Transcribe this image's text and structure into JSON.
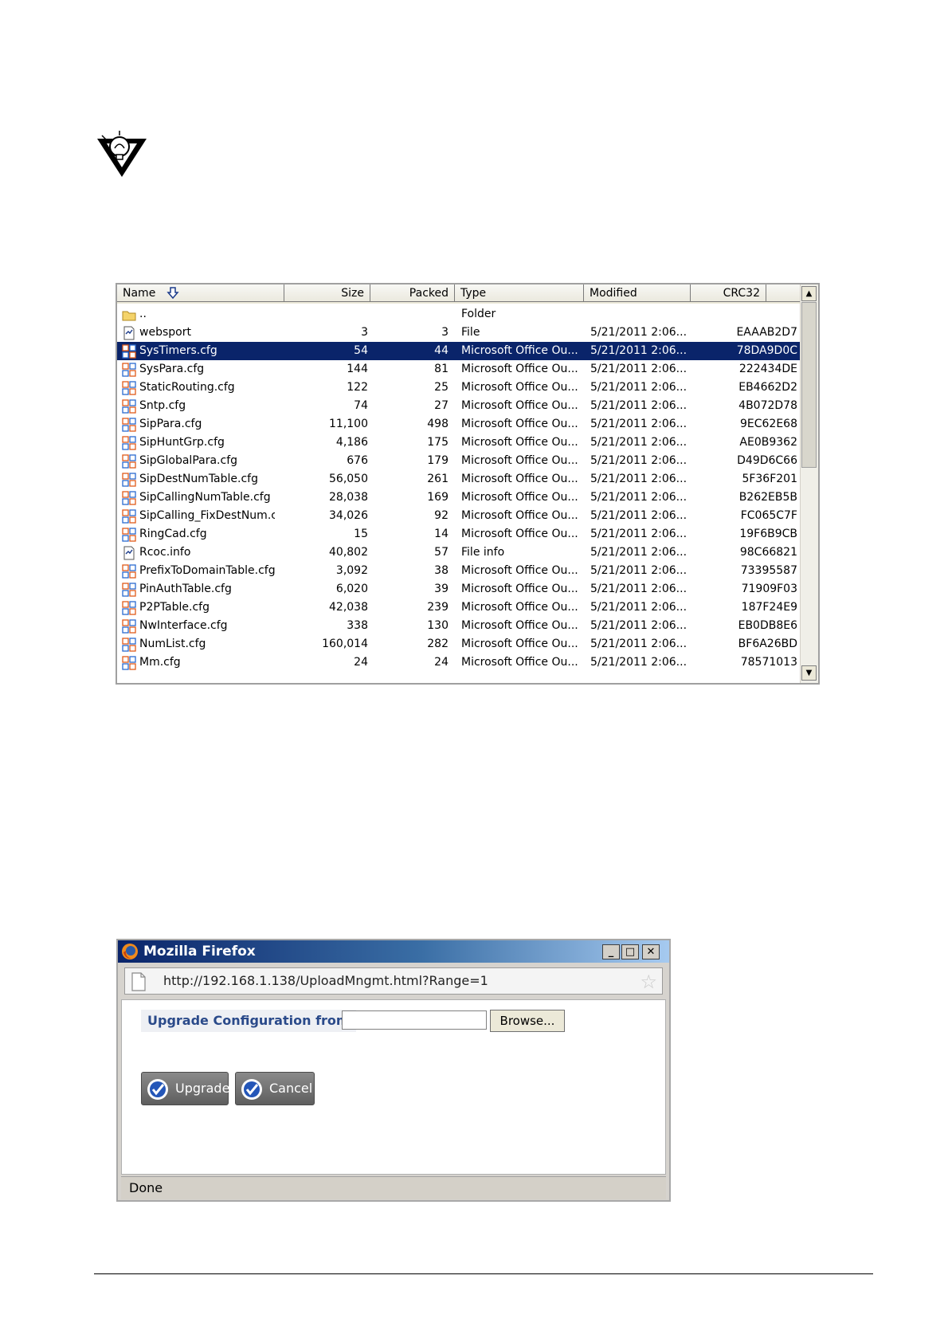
{
  "archive": {
    "columns": {
      "name": "Name",
      "size": "Size",
      "packed": "Packed",
      "type": "Type",
      "modified": "Modified",
      "crc32": "CRC32"
    },
    "rows": [
      {
        "icon": "folder-icon",
        "name": "..",
        "size": "",
        "packed": "",
        "type": "Folder",
        "modified": "",
        "crc": "",
        "selected": false
      },
      {
        "icon": "file-icon",
        "name": "websport",
        "size": "3",
        "packed": "3",
        "type": "File",
        "modified": "5/21/2011 2:06...",
        "crc": "EAAAB2D7",
        "selected": false
      },
      {
        "icon": "cfg-icon",
        "name": "SysTimers.cfg",
        "size": "54",
        "packed": "44",
        "type": "Microsoft Office Ou...",
        "modified": "5/21/2011 2:06...",
        "crc": "78DA9D0C",
        "selected": true
      },
      {
        "icon": "cfg-icon",
        "name": "SysPara.cfg",
        "size": "144",
        "packed": "81",
        "type": "Microsoft Office Ou...",
        "modified": "5/21/2011 2:06...",
        "crc": "222434DE",
        "selected": false
      },
      {
        "icon": "cfg-icon",
        "name": "StaticRouting.cfg",
        "size": "122",
        "packed": "25",
        "type": "Microsoft Office Ou...",
        "modified": "5/21/2011 2:06...",
        "crc": "EB4662D2",
        "selected": false
      },
      {
        "icon": "cfg-icon",
        "name": "Sntp.cfg",
        "size": "74",
        "packed": "27",
        "type": "Microsoft Office Ou...",
        "modified": "5/21/2011 2:06...",
        "crc": "4B072D78",
        "selected": false
      },
      {
        "icon": "cfg-icon",
        "name": "SipPara.cfg",
        "size": "11,100",
        "packed": "498",
        "type": "Microsoft Office Ou...",
        "modified": "5/21/2011 2:06...",
        "crc": "9EC62E68",
        "selected": false
      },
      {
        "icon": "cfg-icon",
        "name": "SipHuntGrp.cfg",
        "size": "4,186",
        "packed": "175",
        "type": "Microsoft Office Ou...",
        "modified": "5/21/2011 2:06...",
        "crc": "AE0B9362",
        "selected": false
      },
      {
        "icon": "cfg-icon",
        "name": "SipGlobalPara.cfg",
        "size": "676",
        "packed": "179",
        "type": "Microsoft Office Ou...",
        "modified": "5/21/2011 2:06...",
        "crc": "D49D6C66",
        "selected": false
      },
      {
        "icon": "cfg-icon",
        "name": "SipDestNumTable.cfg",
        "size": "56,050",
        "packed": "261",
        "type": "Microsoft Office Ou...",
        "modified": "5/21/2011 2:06...",
        "crc": "5F36F201",
        "selected": false
      },
      {
        "icon": "cfg-icon",
        "name": "SipCallingNumTable.cfg",
        "size": "28,038",
        "packed": "169",
        "type": "Microsoft Office Ou...",
        "modified": "5/21/2011 2:06...",
        "crc": "B262EB5B",
        "selected": false
      },
      {
        "icon": "cfg-icon",
        "name": "SipCalling_FixDestNum.cfg",
        "size": "34,026",
        "packed": "92",
        "type": "Microsoft Office Ou...",
        "modified": "5/21/2011 2:06...",
        "crc": "FC065C7F",
        "selected": false
      },
      {
        "icon": "cfg-icon",
        "name": "RingCad.cfg",
        "size": "15",
        "packed": "14",
        "type": "Microsoft Office Ou...",
        "modified": "5/21/2011 2:06...",
        "crc": "19F6B9CB",
        "selected": false
      },
      {
        "icon": "file-icon",
        "name": "Rcoc.info",
        "size": "40,802",
        "packed": "57",
        "type": "File info",
        "modified": "5/21/2011 2:06...",
        "crc": "98C66821",
        "selected": false
      },
      {
        "icon": "cfg-icon",
        "name": "PrefixToDomainTable.cfg",
        "size": "3,092",
        "packed": "38",
        "type": "Microsoft Office Ou...",
        "modified": "5/21/2011 2:06...",
        "crc": "73395587",
        "selected": false
      },
      {
        "icon": "cfg-icon",
        "name": "PinAuthTable.cfg",
        "size": "6,020",
        "packed": "39",
        "type": "Microsoft Office Ou...",
        "modified": "5/21/2011 2:06...",
        "crc": "71909F03",
        "selected": false
      },
      {
        "icon": "cfg-icon",
        "name": "P2PTable.cfg",
        "size": "42,038",
        "packed": "239",
        "type": "Microsoft Office Ou...",
        "modified": "5/21/2011 2:06...",
        "crc": "187F24E9",
        "selected": false
      },
      {
        "icon": "cfg-icon",
        "name": "NwInterface.cfg",
        "size": "338",
        "packed": "130",
        "type": "Microsoft Office Ou...",
        "modified": "5/21/2011 2:06...",
        "crc": "EB0DB8E6",
        "selected": false
      },
      {
        "icon": "cfg-icon",
        "name": "NumList.cfg",
        "size": "160,014",
        "packed": "282",
        "type": "Microsoft Office Ou...",
        "modified": "5/21/2011 2:06...",
        "crc": "BF6A26BD",
        "selected": false
      },
      {
        "icon": "cfg-icon",
        "name": "Mm.cfg",
        "size": "24",
        "packed": "24",
        "type": "Microsoft Office Ou...",
        "modified": "5/21/2011 2:06...",
        "crc": "78571013",
        "selected": false
      }
    ]
  },
  "firefox": {
    "title": "Mozilla Firefox",
    "url": "http://192.168.1.138/UploadMngmt.html?Range=1",
    "upgrade_label": "Upgrade Configuration from",
    "file_value": "",
    "browse_label": "Browse...",
    "upgrade_button": "Upgrade",
    "cancel_button": "Cancel",
    "status": "Done"
  },
  "colors": {
    "selection": "#0a246a",
    "label_text": "#2a4a8a",
    "cfg_icon": "#e05a1a"
  }
}
